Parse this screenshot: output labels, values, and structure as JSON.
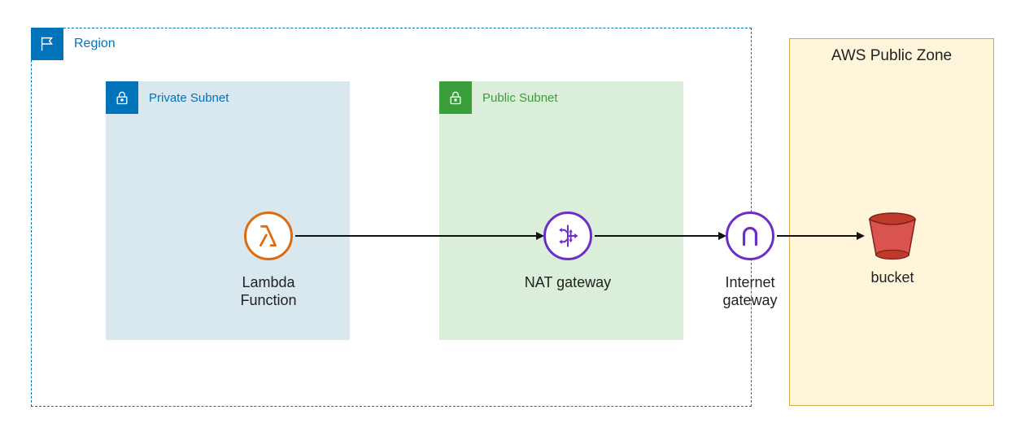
{
  "region": {
    "label": "Region"
  },
  "private_subnet": {
    "label": "Private Subnet"
  },
  "public_subnet": {
    "label": "Public Subnet"
  },
  "lambda": {
    "label_line1": "Lambda",
    "label_line2": "Function"
  },
  "nat": {
    "label": "NAT gateway"
  },
  "igw": {
    "label_line1": "Internet",
    "label_line2": "gateway"
  },
  "public_zone": {
    "label": "AWS Public Zone"
  },
  "bucket": {
    "label": "bucket"
  }
}
